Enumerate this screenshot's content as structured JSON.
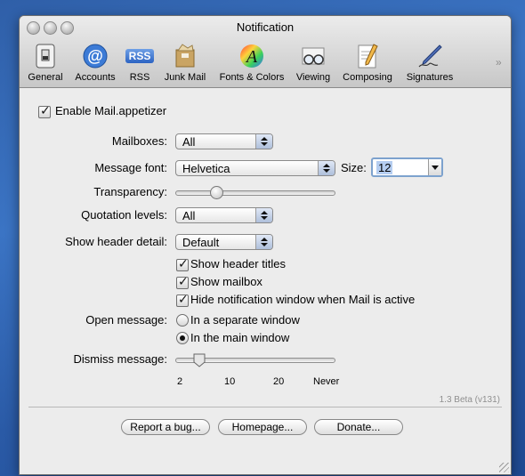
{
  "window": {
    "title": "Notification"
  },
  "toolbar": {
    "items": [
      {
        "label": "General",
        "icon": "general-switch-icon"
      },
      {
        "label": "Accounts",
        "icon": "at-sign-icon"
      },
      {
        "label": "RSS",
        "icon": "rss-icon",
        "badge": "RSS"
      },
      {
        "label": "Junk Mail",
        "icon": "junk-mail-icon"
      },
      {
        "label": "Fonts & Colors",
        "icon": "fonts-colors-icon",
        "glyph": "A"
      },
      {
        "label": "Viewing",
        "icon": "glasses-icon"
      },
      {
        "label": "Composing",
        "icon": "pencil-paper-icon"
      },
      {
        "label": "Signatures",
        "icon": "pen-signature-icon"
      }
    ],
    "overflow": "»"
  },
  "form": {
    "enable": {
      "label": "Enable Mail.appetizer",
      "checked": true
    },
    "mailboxes": {
      "label": "Mailboxes:",
      "value": "All"
    },
    "message_font": {
      "label": "Message font:",
      "value": "Helvetica"
    },
    "size": {
      "label": "Size:",
      "value": "12"
    },
    "transparency": {
      "label": "Transparency:",
      "value_fraction": 0.26
    },
    "quotation_levels": {
      "label": "Quotation levels:",
      "value": "All"
    },
    "show_header_detail": {
      "label": "Show header detail:",
      "value": "Default"
    },
    "checks": [
      {
        "label": "Show header titles",
        "checked": true
      },
      {
        "label": "Show mailbox",
        "checked": true
      },
      {
        "label": "Hide notification window when Mail is active",
        "checked": true
      }
    ],
    "open_message": {
      "label": "Open message:",
      "options": [
        {
          "label": "In a separate window",
          "selected": false
        },
        {
          "label": "In the main window",
          "selected": true
        }
      ]
    },
    "dismiss_message": {
      "label": "Dismiss message:",
      "ticks": [
        "2",
        "10",
        "20",
        "Never"
      ],
      "value_fraction": 0.15
    }
  },
  "version": "1.3 Beta (v131)",
  "buttons": {
    "report": "Report a bug...",
    "homepage": "Homepage...",
    "donate": "Donate..."
  },
  "colors": {
    "desktop": "#3b74c4",
    "window_bg": "#ececec",
    "selection": "#b5cdf0"
  }
}
